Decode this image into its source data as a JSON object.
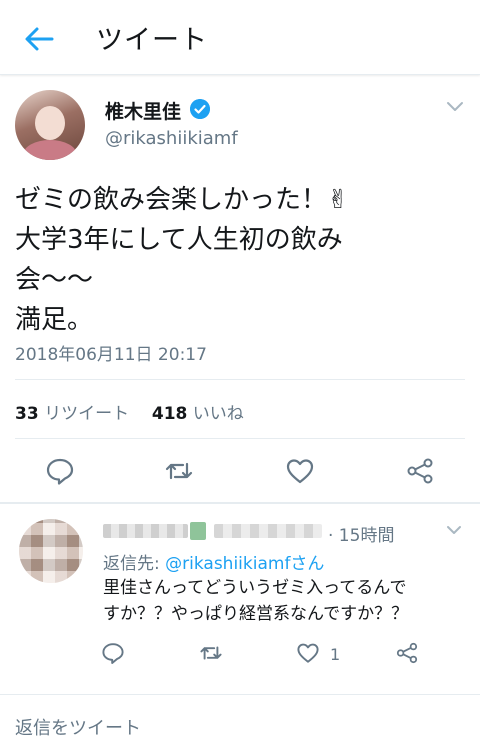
{
  "header": {
    "title": "ツイート"
  },
  "tweet": {
    "display_name": "椎木里佳",
    "handle": "@rikashiikiamf",
    "lines": [
      "ゼミの飲み会楽しかった！✌",
      "大学3年にして人生初の飲み",
      "会〜〜",
      "満足。"
    ],
    "timestamp": "2018年06月11日 20:17",
    "retweet_count": "33",
    "retweet_label": "リツイート",
    "like_count": "418",
    "like_label": "いいね"
  },
  "reply": {
    "time": "· 15時間",
    "reply_to_prefix": "返信先: ",
    "reply_to_handle": "@rikashiikiamfさん",
    "lines": [
      "里佳さんってどういうゼミ入ってるんで",
      "すか？？やっぱり経営系なんですか？？"
    ],
    "like_count": "1"
  },
  "footer": {
    "placeholder": "返信をツイート"
  },
  "colors": {
    "accent": "#1da1f2",
    "muted": "#657786",
    "text": "#14171a"
  },
  "icons": [
    "back-arrow-icon",
    "verified-badge-icon",
    "chevron-down-icon",
    "reply-icon",
    "retweet-icon",
    "like-icon",
    "share-icon"
  ]
}
